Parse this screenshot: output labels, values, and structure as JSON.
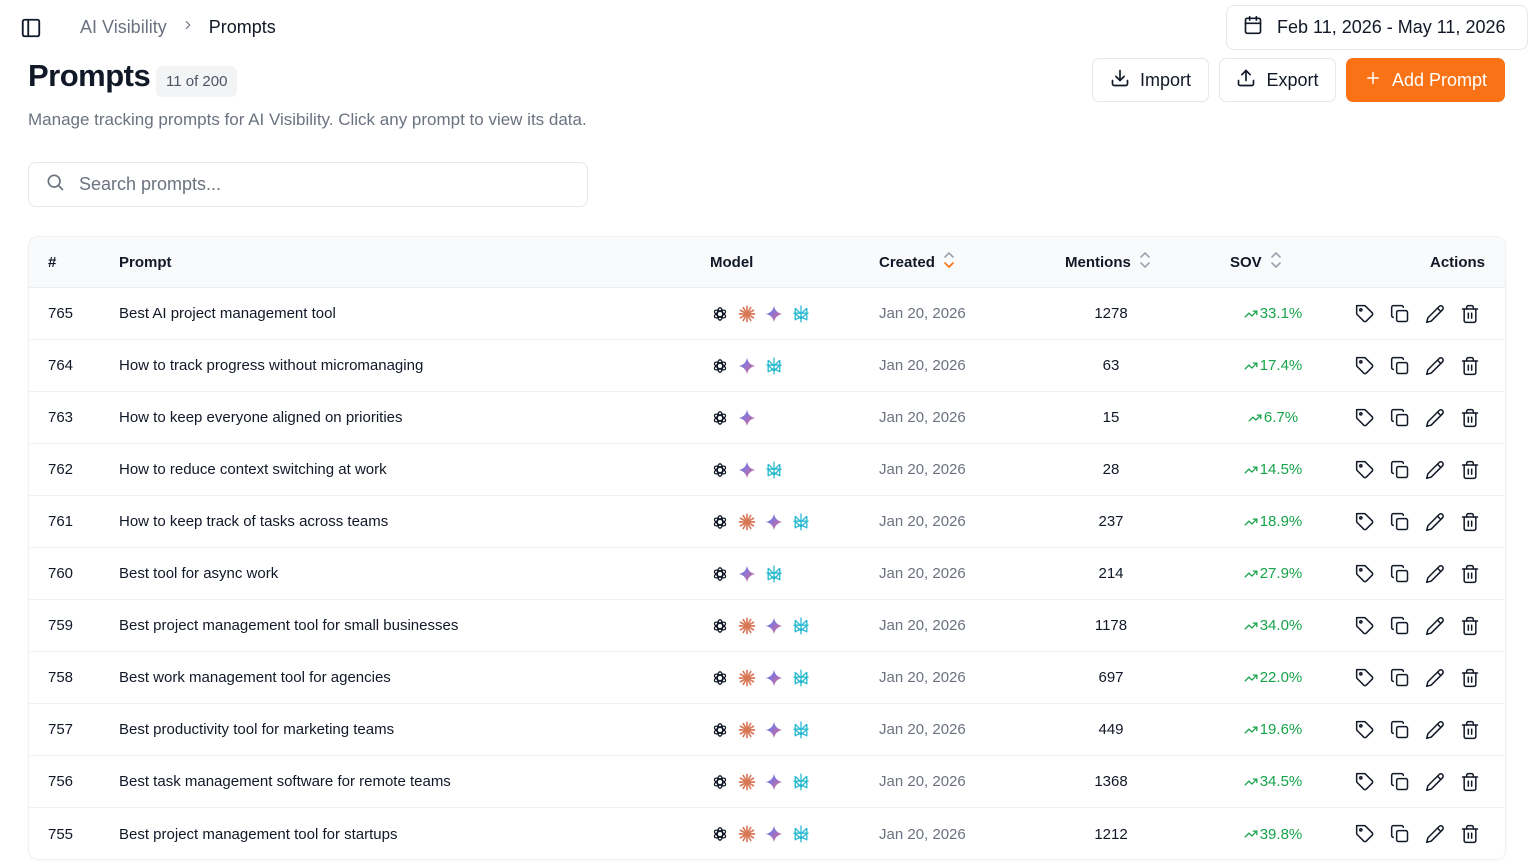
{
  "breadcrumb": {
    "root": "AI Visibility",
    "separator": "›",
    "current": "Prompts"
  },
  "date_range": "Feb 11, 2026 - May 11, 2026",
  "page": {
    "title": "Prompts",
    "count_badge": "11 of 200",
    "subtitle": "Manage tracking prompts for AI Visibility. Click any prompt to view its data."
  },
  "toolbar": {
    "import_label": "Import",
    "export_label": "Export",
    "add_label": "Add Prompt"
  },
  "search": {
    "placeholder": "Search prompts...",
    "value": ""
  },
  "colors": {
    "accent": "#f97316",
    "positive": "#16a34a",
    "claude": "#d97757",
    "perplexity": "#20b8cd"
  },
  "table": {
    "headers": {
      "num": "#",
      "prompt": "Prompt",
      "model": "Model",
      "created": "Created",
      "mentions": "Mentions",
      "sov": "SOV",
      "actions": "Actions"
    },
    "rows": [
      {
        "id": "765",
        "prompt": "Best AI project management tool",
        "models": [
          "chatgpt",
          "claude",
          "gemini",
          "perplexity"
        ],
        "created": "Jan 20, 2026",
        "mentions": "1278",
        "sov": "33.1%"
      },
      {
        "id": "764",
        "prompt": "How to track progress without micromanaging",
        "models": [
          "chatgpt",
          "gemini",
          "perplexity"
        ],
        "created": "Jan 20, 2026",
        "mentions": "63",
        "sov": "17.4%"
      },
      {
        "id": "763",
        "prompt": "How to keep everyone aligned on priorities",
        "models": [
          "chatgpt",
          "gemini"
        ],
        "created": "Jan 20, 2026",
        "mentions": "15",
        "sov": "6.7%"
      },
      {
        "id": "762",
        "prompt": "How to reduce context switching at work",
        "models": [
          "chatgpt",
          "gemini",
          "perplexity"
        ],
        "created": "Jan 20, 2026",
        "mentions": "28",
        "sov": "14.5%"
      },
      {
        "id": "761",
        "prompt": "How to keep track of tasks across teams",
        "models": [
          "chatgpt",
          "claude",
          "gemini",
          "perplexity"
        ],
        "created": "Jan 20, 2026",
        "mentions": "237",
        "sov": "18.9%"
      },
      {
        "id": "760",
        "prompt": "Best tool for async work",
        "models": [
          "chatgpt",
          "gemini",
          "perplexity"
        ],
        "created": "Jan 20, 2026",
        "mentions": "214",
        "sov": "27.9%"
      },
      {
        "id": "759",
        "prompt": "Best project management tool for small businesses",
        "models": [
          "chatgpt",
          "claude",
          "gemini",
          "perplexity"
        ],
        "created": "Jan 20, 2026",
        "mentions": "1178",
        "sov": "34.0%"
      },
      {
        "id": "758",
        "prompt": "Best work management tool for agencies",
        "models": [
          "chatgpt",
          "claude",
          "gemini",
          "perplexity"
        ],
        "created": "Jan 20, 2026",
        "mentions": "697",
        "sov": "22.0%"
      },
      {
        "id": "757",
        "prompt": "Best productivity tool for marketing teams",
        "models": [
          "chatgpt",
          "claude",
          "gemini",
          "perplexity"
        ],
        "created": "Jan 20, 2026",
        "mentions": "449",
        "sov": "19.6%"
      },
      {
        "id": "756",
        "prompt": "Best task management software for remote teams",
        "models": [
          "chatgpt",
          "claude",
          "gemini",
          "perplexity"
        ],
        "created": "Jan 20, 2026",
        "mentions": "1368",
        "sov": "34.5%"
      },
      {
        "id": "755",
        "prompt": "Best project management tool for startups",
        "models": [
          "chatgpt",
          "claude",
          "gemini",
          "perplexity"
        ],
        "created": "Jan 20, 2026",
        "mentions": "1212",
        "sov": "39.8%"
      }
    ],
    "row_actions": [
      "tag-icon",
      "copy-icon",
      "edit-icon",
      "trash-icon"
    ]
  }
}
